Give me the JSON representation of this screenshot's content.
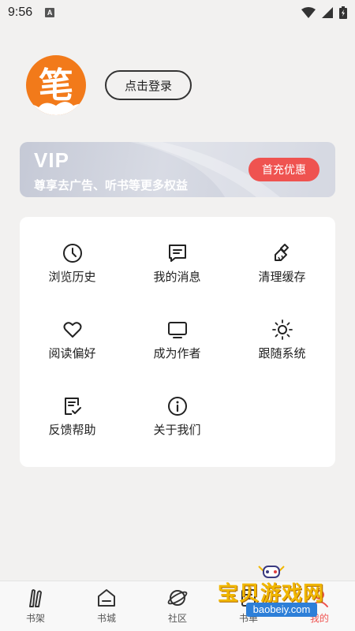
{
  "status_bar": {
    "time": "9:56",
    "notification_badge": "A"
  },
  "profile": {
    "avatar_char": "笔",
    "login_label": "点击登录"
  },
  "vip": {
    "title": "VIP",
    "subtitle": "尊享去广告、听书等更多权益",
    "button_label": "首充优惠"
  },
  "menu": [
    {
      "label": "浏览历史",
      "icon": "clock-icon"
    },
    {
      "label": "我的消息",
      "icon": "message-icon"
    },
    {
      "label": "清理缓存",
      "icon": "broom-icon"
    },
    {
      "label": "阅读偏好",
      "icon": "heart-icon"
    },
    {
      "label": "成为作者",
      "icon": "monitor-icon"
    },
    {
      "label": "跟随系统",
      "icon": "sun-icon"
    },
    {
      "label": "反馈帮助",
      "icon": "feedback-icon"
    },
    {
      "label": "关于我们",
      "icon": "info-icon"
    }
  ],
  "nav": [
    {
      "label": "书架",
      "icon": "bookshelf-icon"
    },
    {
      "label": "书城",
      "icon": "store-icon"
    },
    {
      "label": "社区",
      "icon": "planet-icon"
    },
    {
      "label": "书单",
      "icon": "booklist-icon"
    },
    {
      "label": "我的",
      "icon": "profile-icon",
      "active": true
    }
  ],
  "watermark": {
    "text": "宝贝游戏网",
    "url": "baobeiy.com"
  },
  "colors": {
    "accent": "#ef5350",
    "avatar": "#f27a1a",
    "background": "#f2f1f0"
  }
}
